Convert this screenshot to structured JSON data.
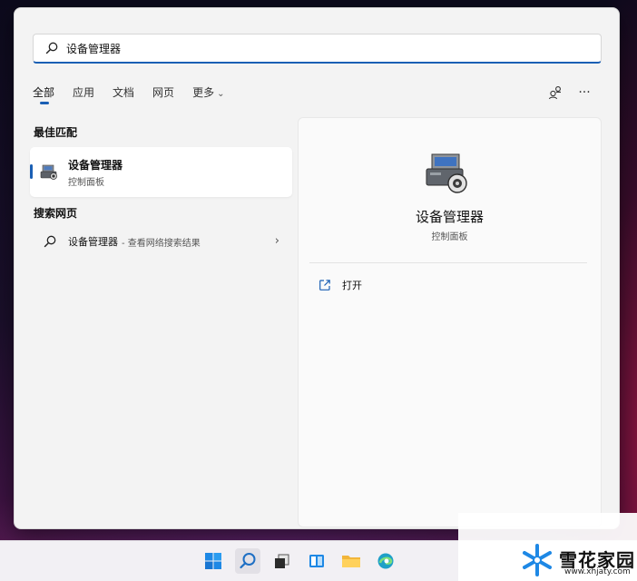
{
  "search": {
    "value": "设备管理器",
    "placeholder": "设备管理器"
  },
  "tabs": [
    {
      "label": "全部",
      "active": true
    },
    {
      "label": "应用",
      "active": false
    },
    {
      "label": "文档",
      "active": false
    },
    {
      "label": "网页",
      "active": false
    },
    {
      "label": "更多",
      "active": false,
      "has_dropdown": true
    }
  ],
  "toolbar_icons": [
    "account-share-icon",
    "more-options-icon"
  ],
  "more_glyph": "···",
  "chevron_glyph": "⌄",
  "best_match": {
    "section_title": "最佳匹配",
    "name": "设备管理器",
    "subtitle": "控制面板",
    "icon": "device-manager-icon"
  },
  "web_search": {
    "section_title": "搜索网页",
    "name": "设备管理器",
    "description": "- 查看网络搜索结果",
    "icon": "search-icon",
    "arrow": "›"
  },
  "details": {
    "title": "设备管理器",
    "subtitle": "控制面板",
    "actions": [
      {
        "label": "打开",
        "icon": "open-external-icon"
      }
    ]
  },
  "taskbar": {
    "items": [
      "windows-start-icon",
      "search-icon",
      "task-view-icon",
      "widgets-icon",
      "file-explorer-icon",
      "edge-browser-icon"
    ]
  },
  "watermark": {
    "main": "雪花家园",
    "url": "www.xhjaty.com"
  },
  "colors": {
    "accent": "#1a5fb4",
    "panel_bg": "#f3f3f3",
    "card_bg": "#ffffff"
  }
}
